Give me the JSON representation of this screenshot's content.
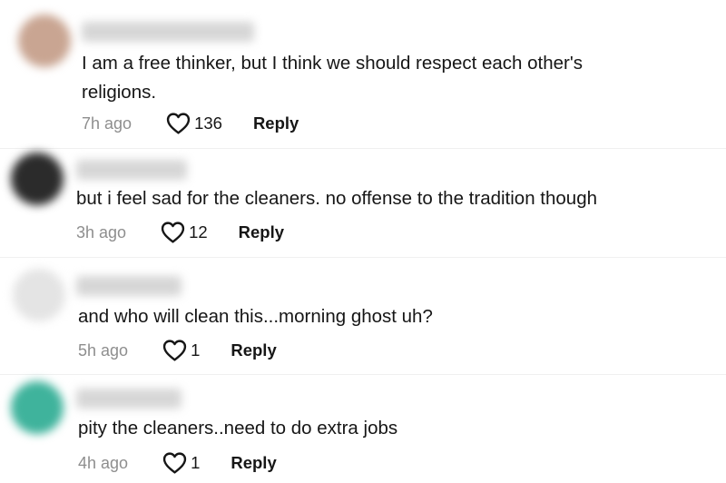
{
  "comments": [
    {
      "text_lines": [
        "I am a free thinker, but I think we should respect each other's",
        "religions."
      ],
      "time": "7h ago",
      "likes": "136",
      "reply_label": "Reply",
      "avatar_color": "#c9a592"
    },
    {
      "text_lines": [
        "but i feel sad for the cleaners. no offense to the tradition though"
      ],
      "time": "3h ago",
      "likes": "12",
      "reply_label": "Reply",
      "avatar_color": "#2b2b2b"
    },
    {
      "text_lines": [
        "and who will clean this...morning ghost uh?"
      ],
      "time": "5h ago",
      "likes": "1",
      "reply_label": "Reply",
      "avatar_color": "#e4e4e4"
    },
    {
      "text_lines": [
        "pity the cleaners..need to do extra jobs"
      ],
      "time": "4h ago",
      "likes": "1",
      "reply_label": "Reply",
      "avatar_color": "#3fb39c"
    }
  ],
  "icons": {
    "like": "heart-outline-icon"
  }
}
